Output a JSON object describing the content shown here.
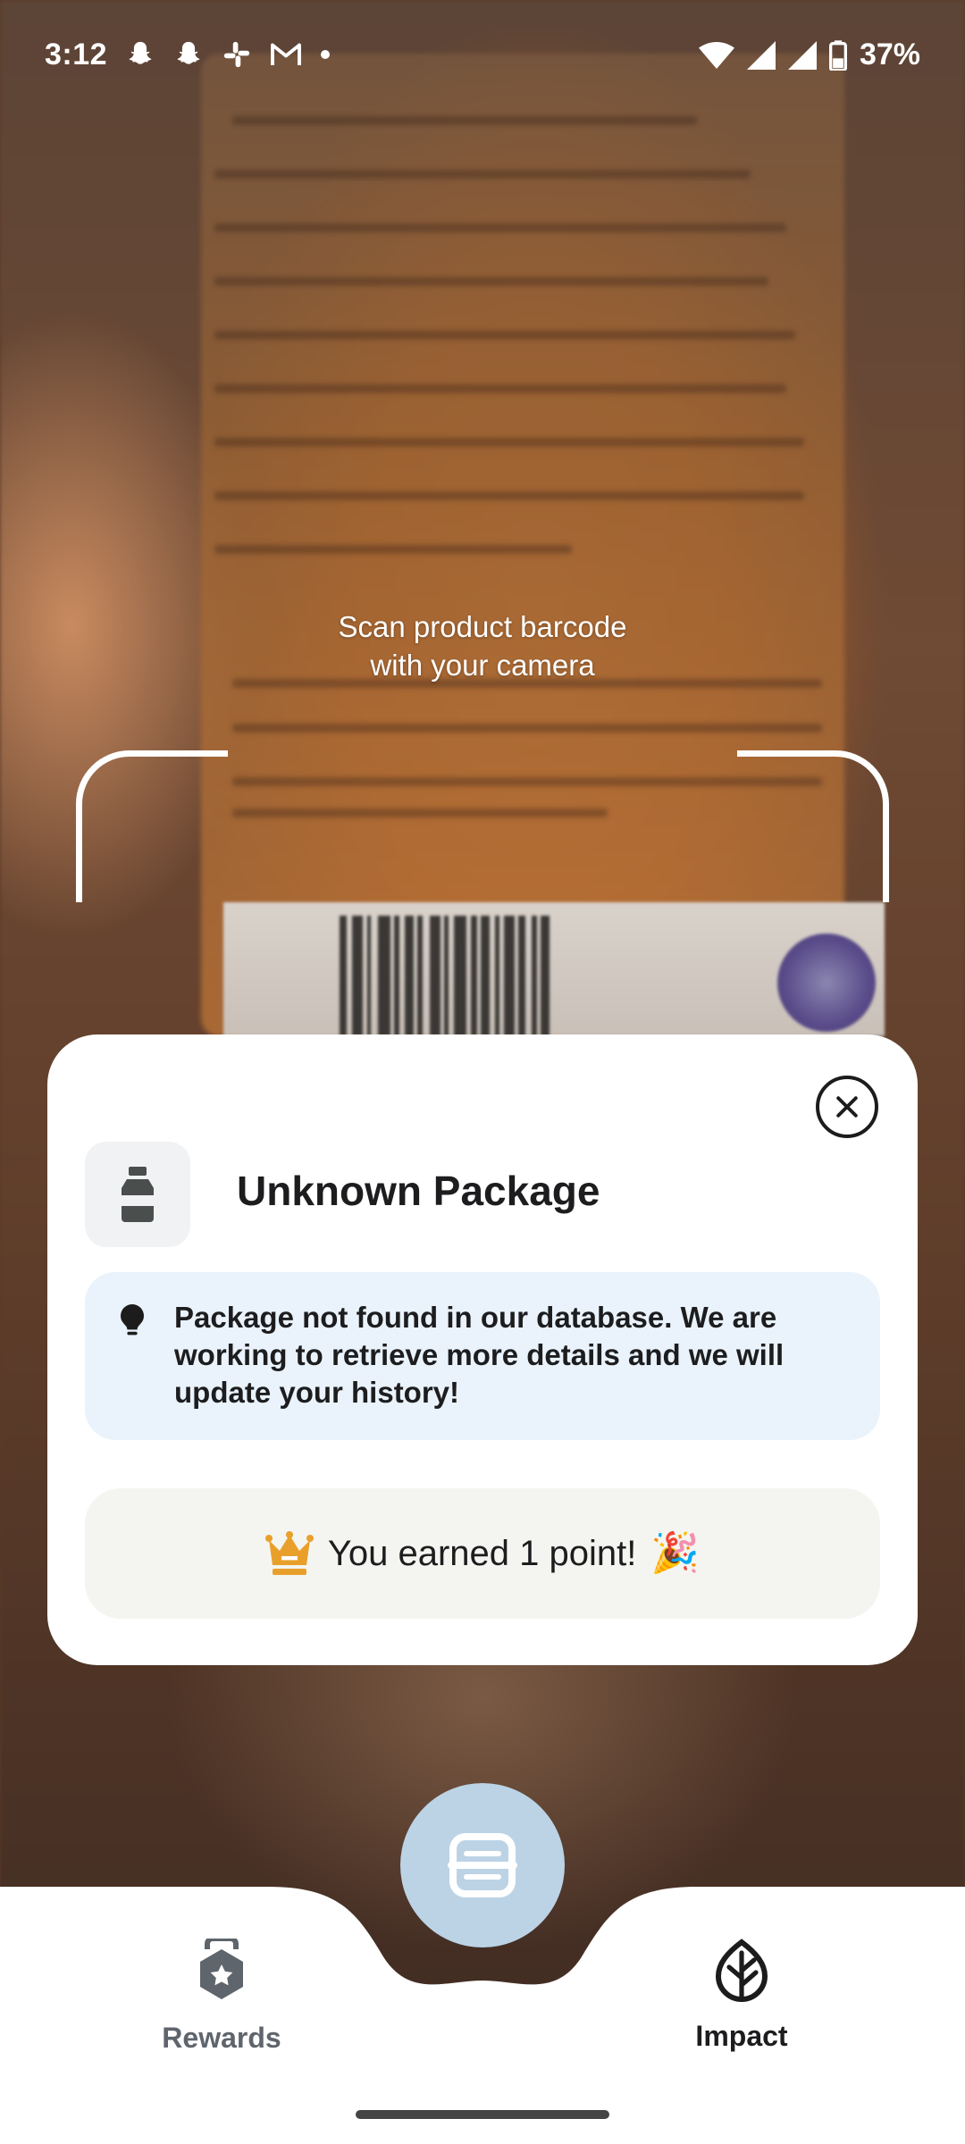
{
  "status_bar": {
    "time": "3:12",
    "notification_icons": [
      "snapchat-icon",
      "snapchat-icon",
      "slack-icon",
      "gmail-icon",
      "dot-icon"
    ],
    "battery": "37%"
  },
  "scanner": {
    "prompt_line1": "Scan product barcode",
    "prompt_line2": "with your camera"
  },
  "result_card": {
    "title": "Unknown Package",
    "notice": "Package not found in our database. We are working to retrieve more details and we will update your history!",
    "points_text": "You earned 1 point!",
    "points_emoji": "🎉",
    "colors": {
      "notice_bg": "#eaf3fb",
      "points_bg": "#f4f5f0",
      "crown": "#e9a02b"
    }
  },
  "bottom_nav": {
    "rewards_label": "Rewards",
    "impact_label": "Impact",
    "scan_button_color": "#bcd3e6"
  }
}
